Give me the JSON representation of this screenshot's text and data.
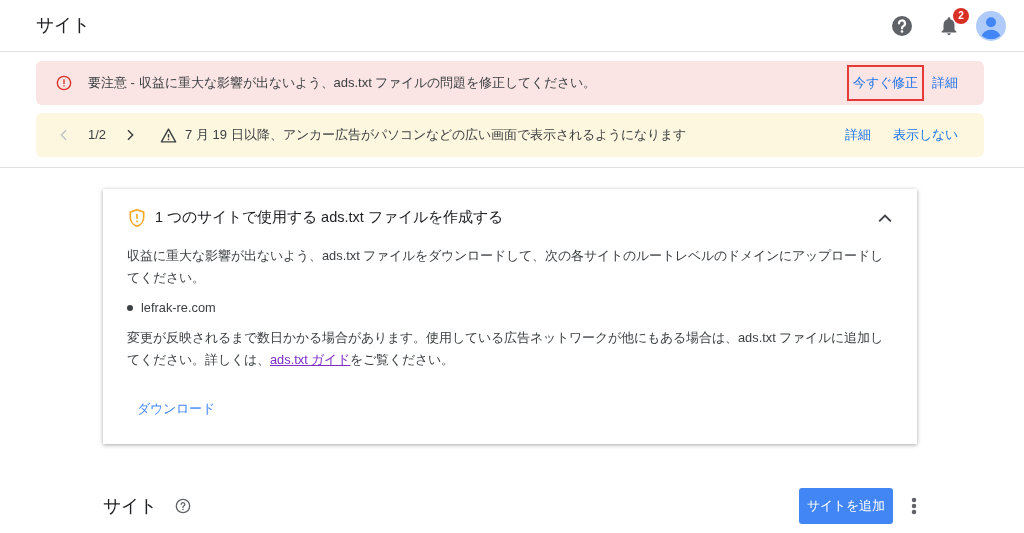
{
  "header": {
    "title": "サイト",
    "notification_count": "2"
  },
  "alert": {
    "text": "要注意 - 収益に重大な影響が出ないよう、ads.txt ファイルの問題を修正してください。",
    "actions": [
      {
        "label": "今すぐ修正",
        "highlighted": true
      },
      {
        "label": "詳細",
        "highlighted": false
      }
    ]
  },
  "notice": {
    "pager": "1/2",
    "text": "7 月 19 日以降、アンカー広告がパソコンなどの広い画面で表示されるようになります",
    "actions": [
      "詳細",
      "表示しない"
    ]
  },
  "card": {
    "title": "1 つのサイトで使用する ads.txt ファイルを作成する",
    "expanded": true,
    "intro": "収益に重大な影響が出ないよう、ads.txt ファイルをダウンロードして、次の各サイトのルートレベルのドメインにアップロードしてください。",
    "sites": [
      "lefrak-re.com"
    ],
    "note_before": "変更が反映されるまで数日かかる場合があります。使用している広告ネットワークが他にもある場合は、ads.txt ファイルに追加してください。詳しくは、",
    "note_link": "ads.txt ガイド",
    "note_after": "をご覧ください。",
    "action": "ダウンロード"
  },
  "section": {
    "title": "サイト",
    "add_button": "サイトを追加"
  }
}
